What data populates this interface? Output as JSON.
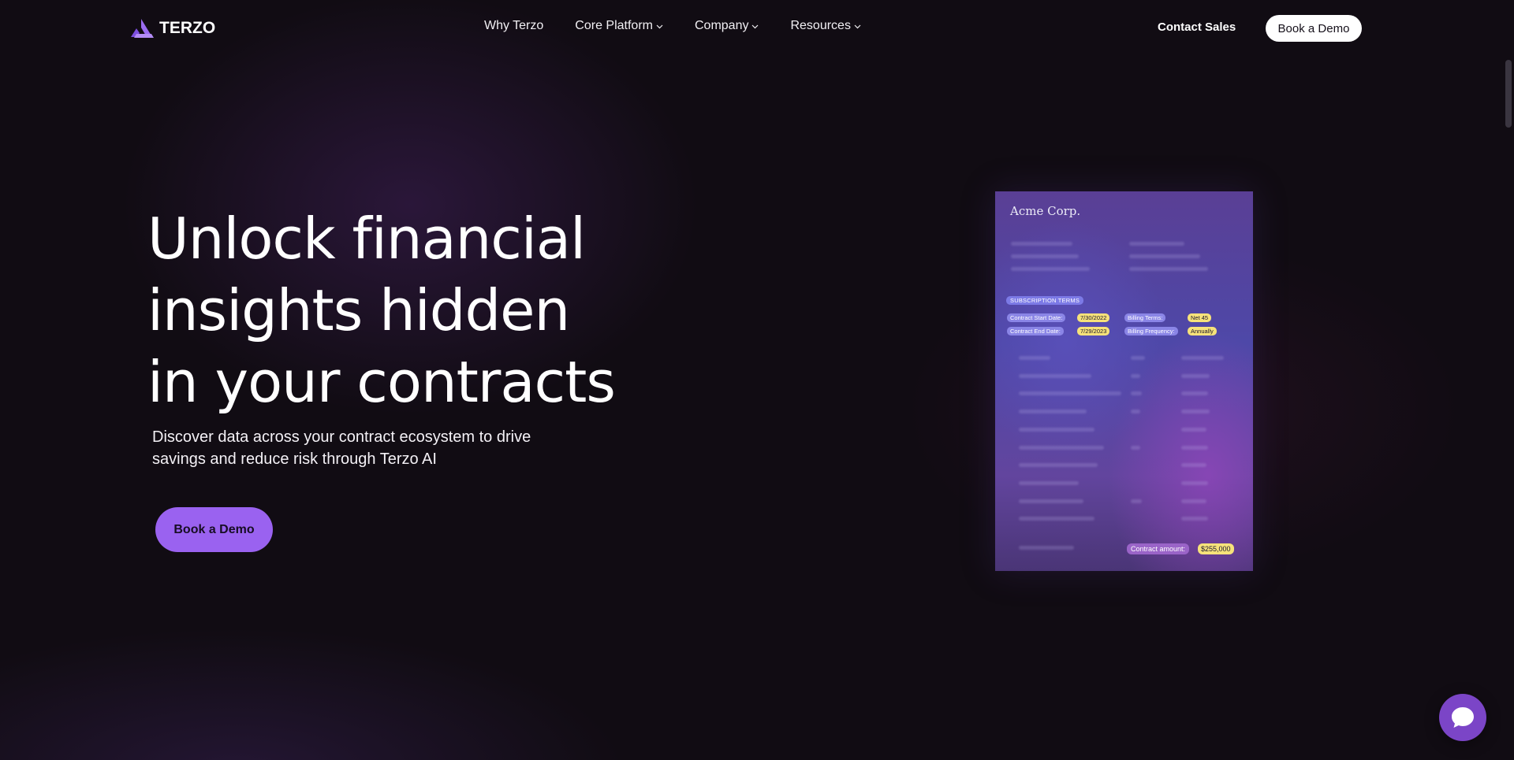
{
  "header": {
    "logo_text": "TERZO",
    "nav": [
      {
        "label": "Why Terzo",
        "has_dropdown": false
      },
      {
        "label": "Core Platform",
        "has_dropdown": true
      },
      {
        "label": "Company",
        "has_dropdown": true
      },
      {
        "label": "Resources",
        "has_dropdown": true
      }
    ],
    "contact_sales": "Contact Sales",
    "book_demo": "Book a Demo"
  },
  "hero": {
    "title_lines": [
      "Unlock financial",
      "insights hidden",
      "in your contracts"
    ],
    "subtitle_lines": [
      "Discover data across your contract ecosystem to drive",
      "savings and reduce risk through Terzo AI"
    ],
    "cta": "Book a Demo"
  },
  "document": {
    "company": "Acme Corp.",
    "section_badge": "SUBSCRIPTION TERMS",
    "tags": [
      {
        "label": "Contract Start Date:",
        "value": "7/30/2022"
      },
      {
        "label": "Billing Terms:",
        "value": "Net 45"
      },
      {
        "label": "Contract End Date:",
        "value": "7/29/2023"
      },
      {
        "label": "Billing Frequency:",
        "value": "Annually"
      }
    ],
    "amount_label": "Contract amount:",
    "amount_value": "$255,000"
  },
  "colors": {
    "background": "#110c13",
    "accent": "#9a62f0",
    "highlight": "#f6e27a",
    "chat": "#7b45c7"
  },
  "icons": {
    "logo": "terzo-logo-icon",
    "dropdown": "chevron-down-icon",
    "chat": "chat-bubble-icon"
  }
}
